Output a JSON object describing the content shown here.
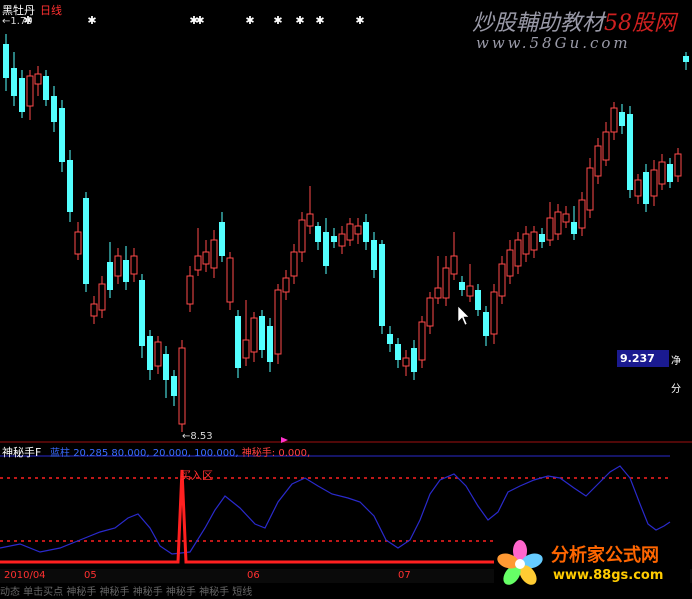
{
  "header": {
    "stock_name": "黑牡丹",
    "period": "日线",
    "high_marker": "1.70"
  },
  "watermark": {
    "line1_prefix": "炒股輔助教材",
    "line1_brand": "58股网",
    "line2": "www.58Gu.com"
  },
  "price_panel": {
    "low_label": "8.53",
    "current_price": "9.237",
    "side_label_1": "净",
    "side_label_2": "分"
  },
  "indicator": {
    "name": "神秘手F",
    "params_blue_prefix": "蓝柱",
    "params_blue_value": "20.285",
    "params_values": "80.000, 20.000, 100.000,",
    "params_red": "神秘手: 0.000,",
    "buy_zone_label": "买入区"
  },
  "date_axis": {
    "labels": [
      "2010/04",
      "05",
      "06",
      "07"
    ]
  },
  "bottom_strip": "动态  单击买点  神秘手  神秘手  神秘手  神秘手  神秘手  短线",
  "logo": {
    "text": "分析家公式网",
    "url": "www.88gs.com"
  },
  "colors": {
    "up_candle": "#ff4a4a",
    "down_candle": "#54ffff",
    "indicator_line": "#2a2acc",
    "signal_line": "#ff2020",
    "dotted_level": "#ff2020",
    "price_tag_bg": "#1a1a90"
  },
  "icons": [
    "mouse-pointer-icon",
    "star-marker-icon",
    "logo-flower-icon"
  ]
}
